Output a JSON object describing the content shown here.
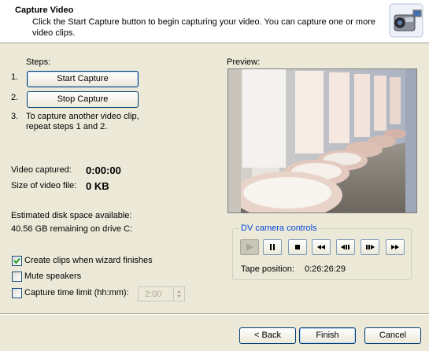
{
  "header": {
    "title": "Capture Video",
    "description": "Click the Start Capture button to begin capturing your video. You can capture one or more video clips.",
    "icon": "camcorder-icon"
  },
  "steps": {
    "label": "Steps:",
    "n1": "1.",
    "n2": "2.",
    "n3": "3.",
    "start_label": "Start Capture",
    "stop_label": "Stop Capture",
    "step3_line1": "To capture another video clip,",
    "step3_line2": "repeat steps 1 and 2."
  },
  "stats": {
    "video_captured_label": "Video captured:",
    "video_captured_value": "0:00:00",
    "size_label": "Size of video file:",
    "size_value": "0 KB",
    "disk_label": "Estimated disk space available:",
    "disk_value": "40.56 GB remaining on drive C:"
  },
  "options": {
    "create_clips": {
      "label": "Create clips when wizard finishes",
      "checked": true
    },
    "mute": {
      "label": "Mute speakers",
      "checked": false
    },
    "time_limit": {
      "label": "Capture time limit (hh:mm):",
      "checked": false,
      "value": "2:00"
    }
  },
  "preview": {
    "label": "Preview:"
  },
  "dv_controls": {
    "title": "DV camera controls",
    "tape_position_label": "Tape position:",
    "tape_position_value": "0:26:26:29",
    "buttons": [
      "play-icon",
      "pause-icon",
      "stop-icon",
      "rewind-icon",
      "step-back-icon",
      "step-forward-icon",
      "fast-forward-icon"
    ]
  },
  "footer": {
    "back_label": "< Back",
    "finish_label": "Finish",
    "cancel_label": "Cancel"
  },
  "colors": {
    "dialog_bg": "#ece9d8",
    "group_title": "#0046d5",
    "button_border": "#003c74"
  }
}
